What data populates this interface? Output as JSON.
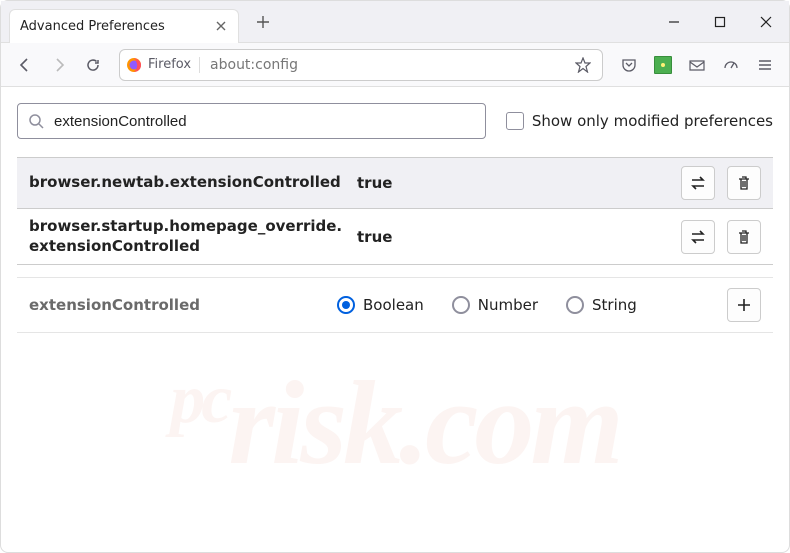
{
  "titlebar": {
    "tab_title": "Advanced Preferences"
  },
  "toolbar": {
    "identity_label": "Firefox",
    "url": "about:config"
  },
  "search": {
    "value": "extensionControlled",
    "checkbox_label": "Show only modified preferences"
  },
  "results": [
    {
      "name": "browser.newtab.extensionControlled",
      "value": "true"
    },
    {
      "name": "browser.startup.homepage_override.extensionControlled",
      "value": "true"
    }
  ],
  "new_pref": {
    "name": "extensionControlled",
    "types": [
      "Boolean",
      "Number",
      "String"
    ],
    "selected": "Boolean"
  },
  "watermark": {
    "prefix": "pc",
    "main": "risk.com"
  }
}
